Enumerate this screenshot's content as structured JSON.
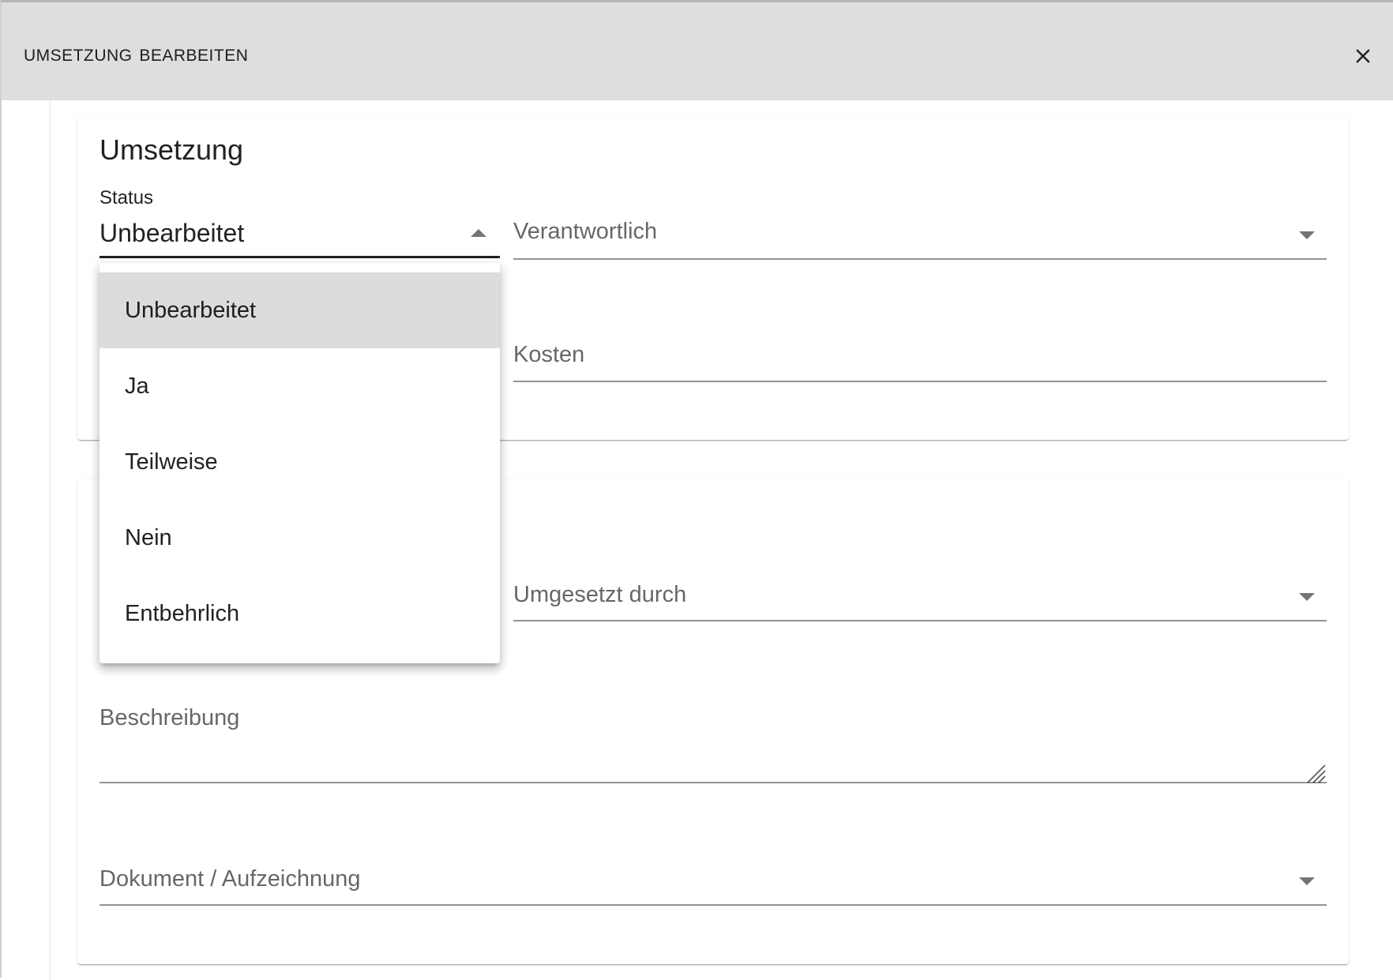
{
  "dialog": {
    "title": "Umsetzung bearbeiten",
    "close_icon": "close-icon"
  },
  "section_umsetzung": {
    "title": "Umsetzung",
    "status": {
      "label": "Status",
      "value": "Unbearbeitet",
      "options": [
        "Unbearbeitet",
        "Ja",
        "Teilweise",
        "Nein",
        "Entbehrlich"
      ],
      "selected_index": 0
    },
    "verantwortlich": {
      "placeholder": "Verantwortlich"
    },
    "kosten": {
      "placeholder": "Kosten"
    }
  },
  "section_details": {
    "umgesetzt_durch": {
      "placeholder": "Umgesetzt durch"
    },
    "beschreibung": {
      "placeholder": "Beschreibung"
    },
    "dokument": {
      "placeholder": "Dokument / Aufzeichnung"
    }
  },
  "colors": {
    "header_bg": "#dedede",
    "selected_item_bg": "#dcdcdc",
    "text_primary": "#212121",
    "text_secondary": "#666666"
  }
}
